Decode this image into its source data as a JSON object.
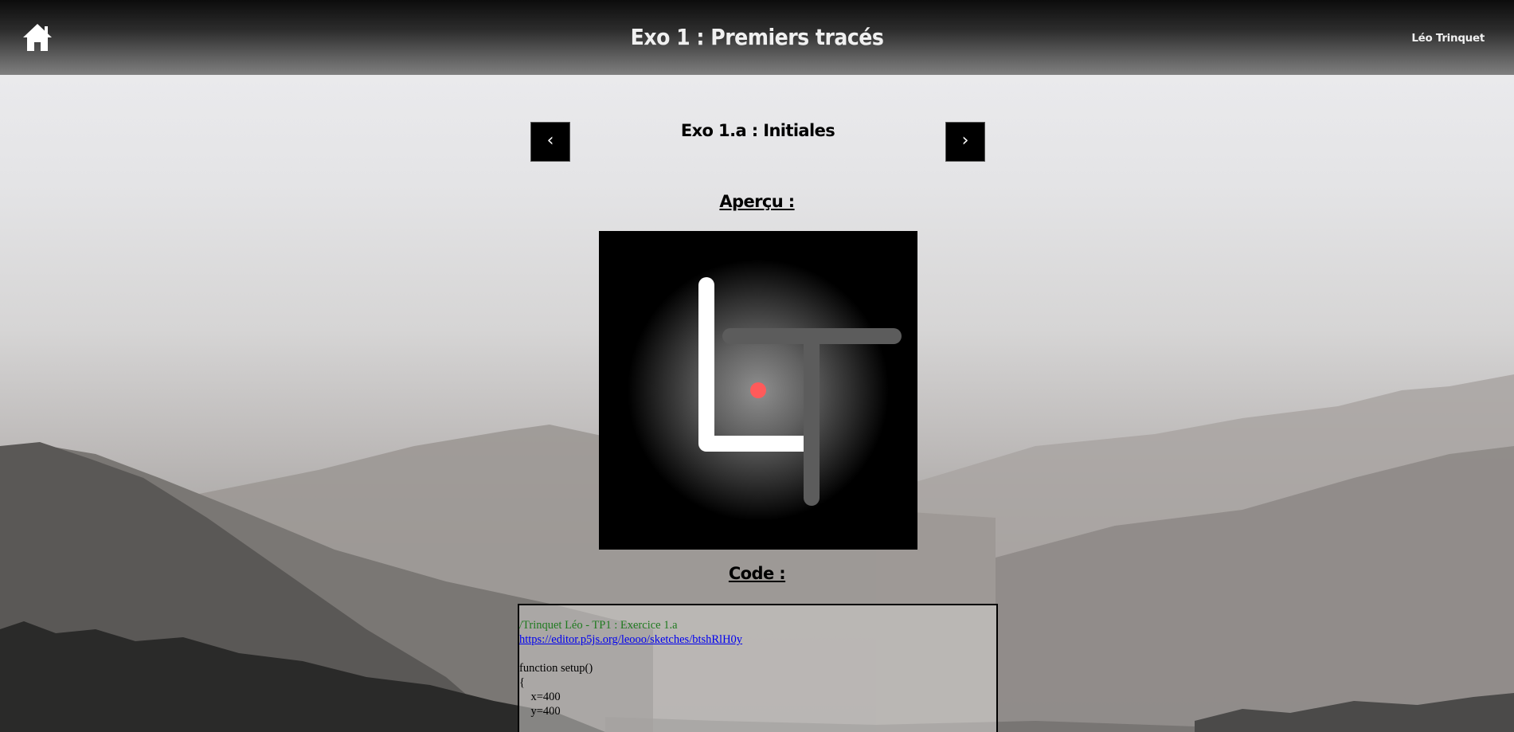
{
  "header": {
    "home_icon": "home-icon",
    "title": "Exo 1 : Premiers tracés",
    "author": "Léo Trinquet"
  },
  "exercise": {
    "prev_label": "‹",
    "next_label": "›",
    "title": "Exo 1.a : Initiales"
  },
  "sections": {
    "preview_label": "Aperçu :",
    "code_label": "Code :"
  },
  "code": {
    "comment_line": "/Trinquet Léo - TP1 : Exercice 1.a",
    "link_line": "https://editor.p5js.org/leooo/sketches/btshRlH0y",
    "lines": [
      "",
      "function setup()",
      "{",
      "    x=400",
      "    y=400"
    ]
  },
  "colors": {
    "header_top": "#0c0c0c",
    "header_bottom": "#7f7f7f",
    "nav_button": "#000000",
    "dot": "#ff5a5a",
    "letter_L": "#ffffff",
    "letter_T": "#5a5a5a",
    "code_comment": "#1f7a1f",
    "code_link": "#0000ee"
  }
}
